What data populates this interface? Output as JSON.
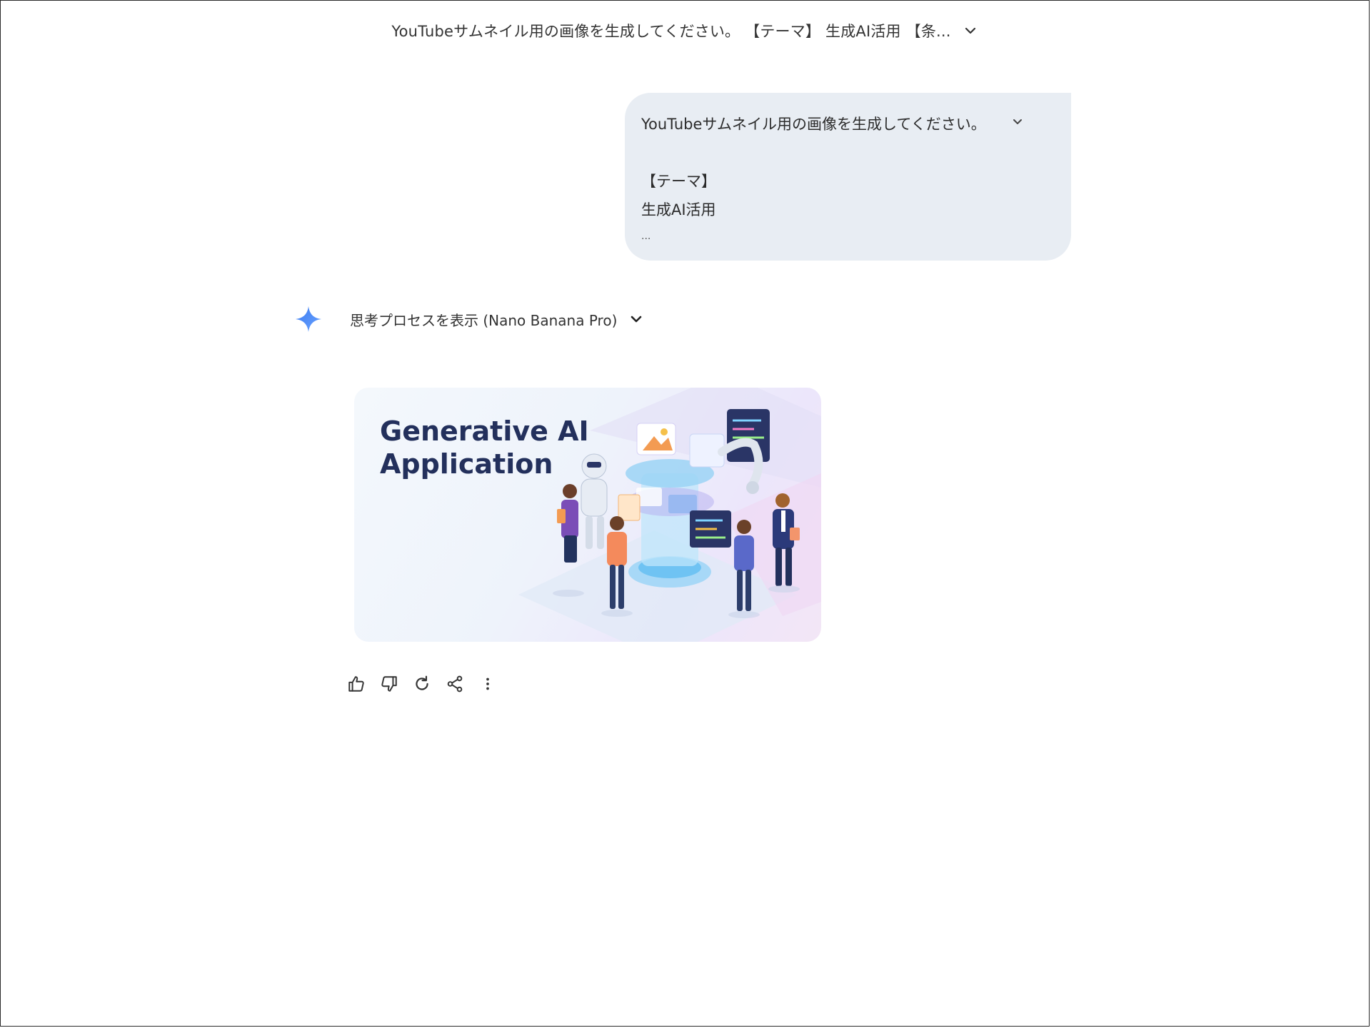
{
  "header": {
    "title": "YouTubeサムネイル用の画像を生成してください。 【テーマ】 生成AI活用 【条...",
    "expand_icon": "chevron-down-icon"
  },
  "user_message": {
    "line1": "YouTubeサムネイル用の画像を生成してください。",
    "line2": "【テーマ】",
    "line3": "生成AI活用",
    "ellipsis": "...",
    "expand_icon": "chevron-down-icon"
  },
  "model_response": {
    "avatar_icon": "gemini-sparkle-icon",
    "thinking_label": "思考プロセスを表示 (Nano Banana Pro)",
    "thinking_expand_icon": "chevron-down-icon",
    "image": {
      "headline_line1": "Generative AI",
      "headline_line2": "Application"
    },
    "actions": [
      {
        "icon": "thumbs-up-icon"
      },
      {
        "icon": "thumbs-down-icon"
      },
      {
        "icon": "regenerate-icon"
      },
      {
        "icon": "share-icon"
      },
      {
        "icon": "more-vert-icon"
      }
    ]
  },
  "colors": {
    "bubble": "#e8edf3",
    "sparkle": "#4a86f0",
    "headline": "#23305c"
  }
}
